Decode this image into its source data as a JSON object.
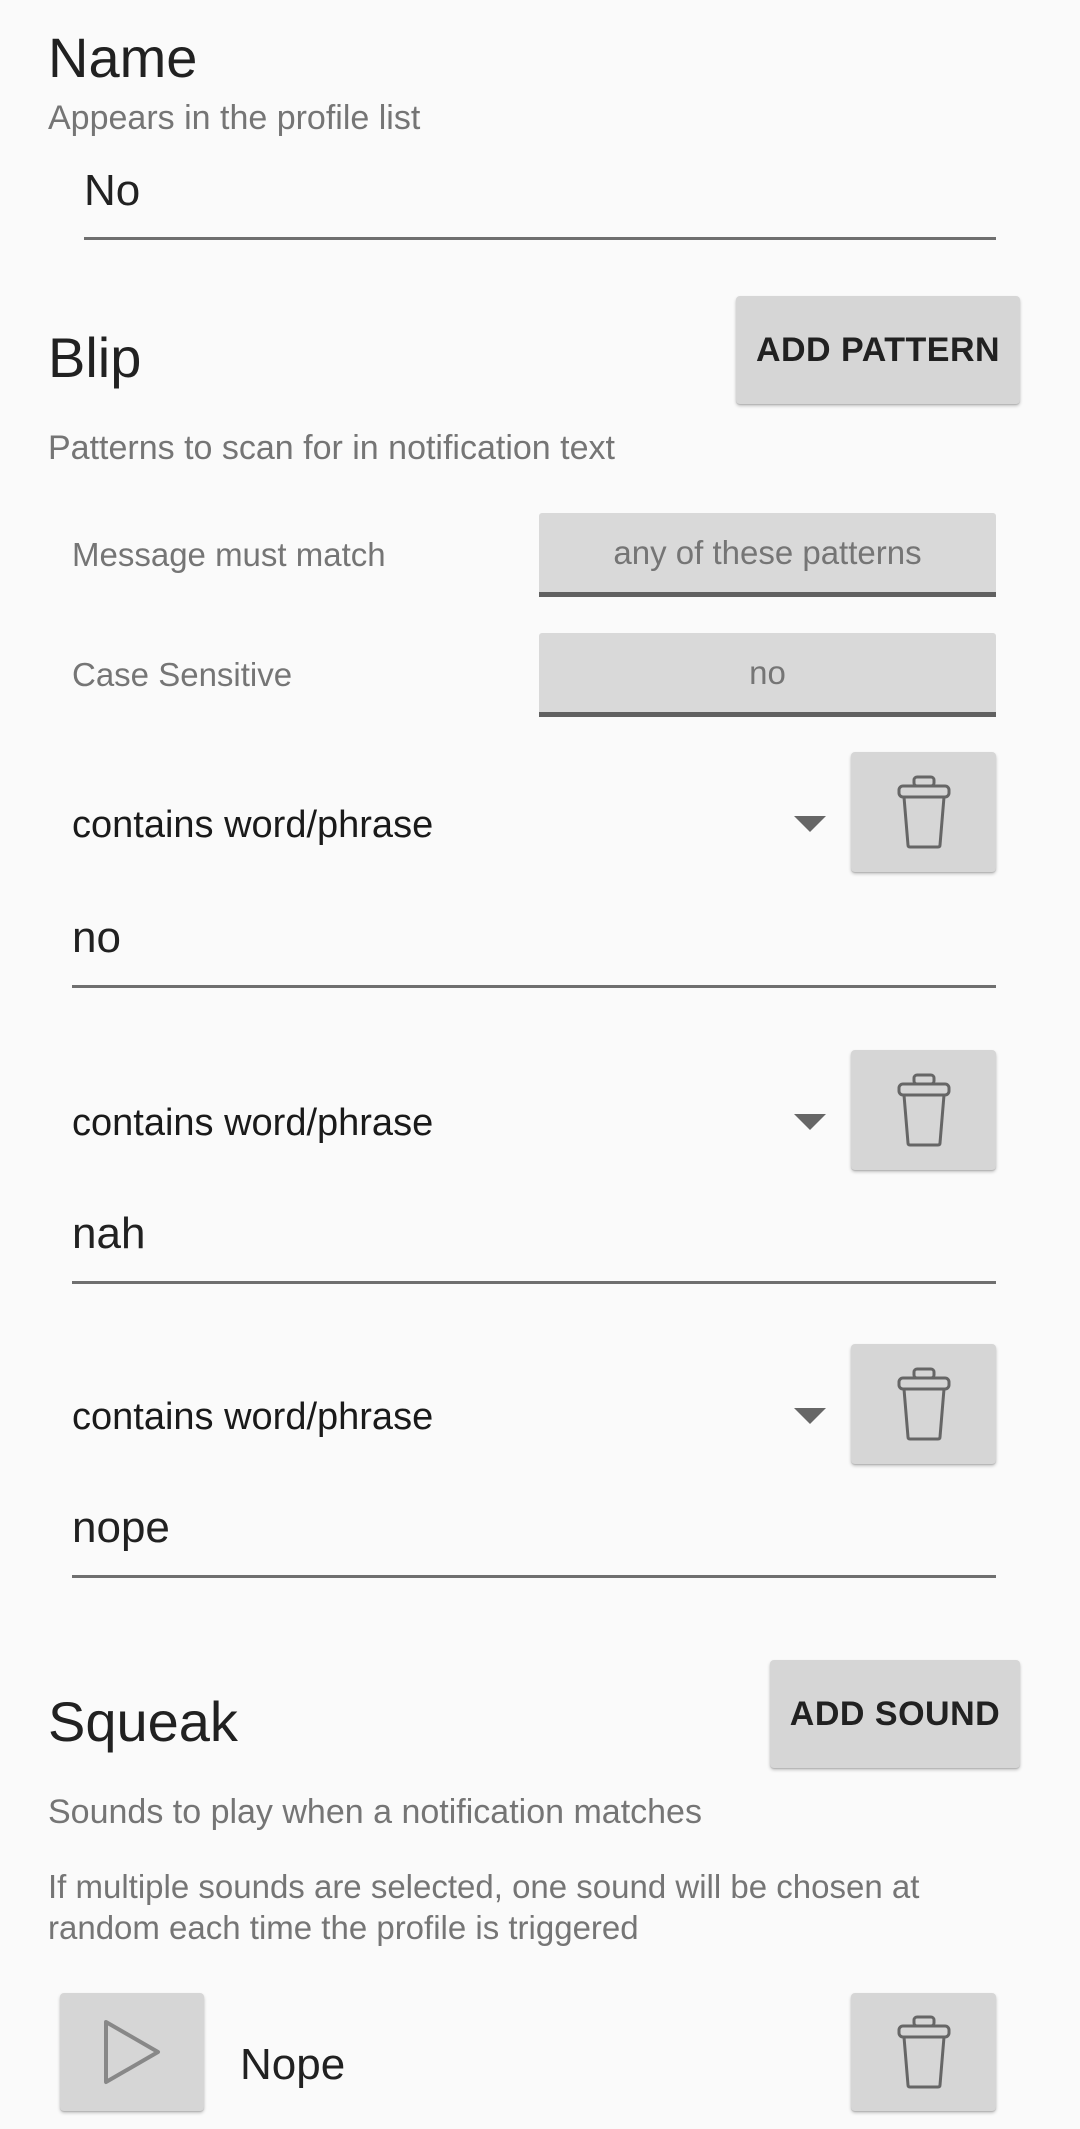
{
  "name_section": {
    "title": "Name",
    "subtitle": "Appears in the profile list",
    "value": "No"
  },
  "blip_section": {
    "title": "Blip",
    "add_button_label": "ADD PATTERN",
    "subtitle": "Patterns to scan for in notification text",
    "match_label": "Message must match",
    "match_value": "any of these patterns",
    "case_label": "Case Sensitive",
    "case_value": "no",
    "patterns": [
      {
        "type": "contains word/phrase",
        "value": "no"
      },
      {
        "type": "contains word/phrase",
        "value": "nah"
      },
      {
        "type": "contains word/phrase",
        "value": "nope"
      }
    ]
  },
  "squeak_section": {
    "title": "Squeak",
    "add_button_label": "ADD SOUND",
    "subtitle": "Sounds to play when a notification matches",
    "note": "If multiple sounds are selected, one sound will be chosen at random each time the profile is triggered",
    "sounds": [
      {
        "name": "Nope"
      }
    ]
  },
  "icons": {
    "delete": "trash-icon",
    "play": "play-icon",
    "dropdown": "dropdown-arrow-icon"
  },
  "colors": {
    "background": "#fafafa",
    "button": "#d6d6d6",
    "text_primary": "#212121",
    "text_secondary": "#757575"
  }
}
